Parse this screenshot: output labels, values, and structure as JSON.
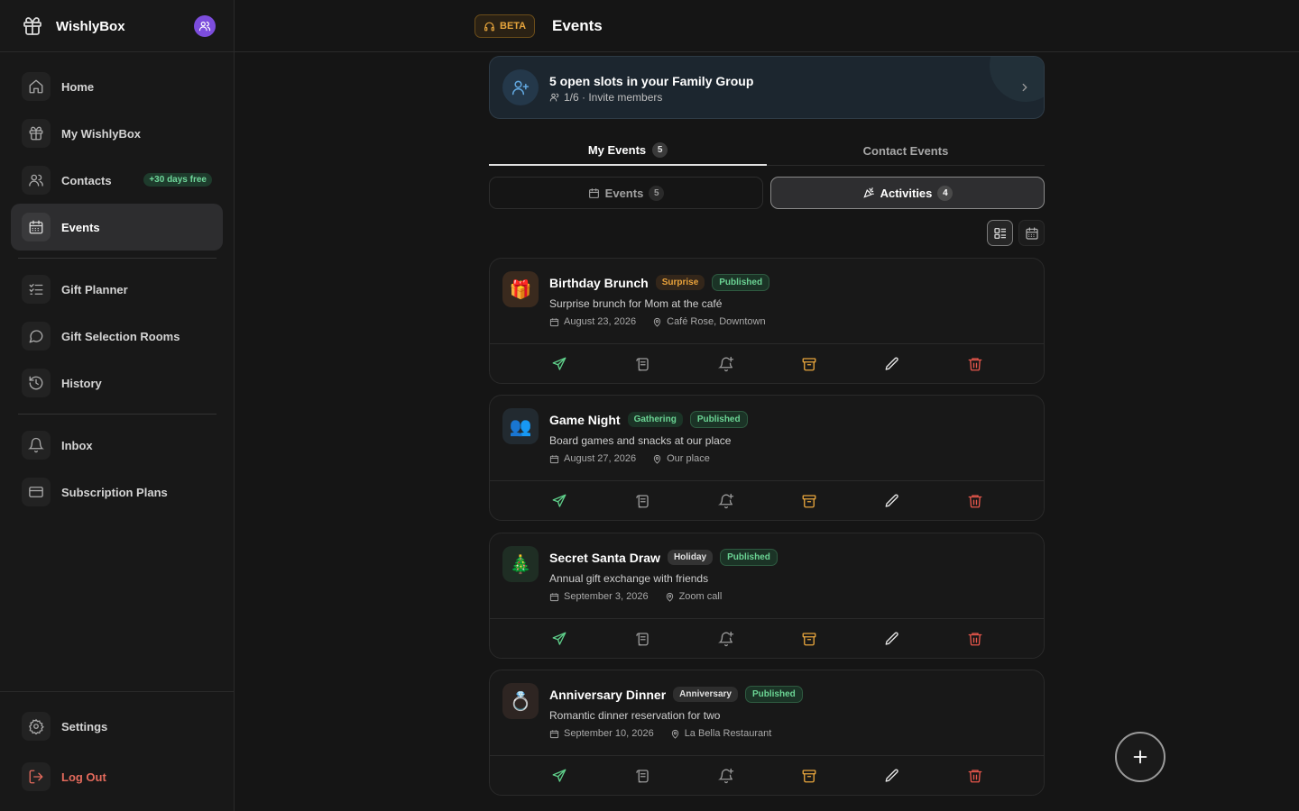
{
  "app": {
    "name": "WishlyBox"
  },
  "header": {
    "beta_label": "BETA",
    "title": "Events"
  },
  "sidebar": {
    "items": [
      {
        "label": "Home",
        "icon": "home-icon"
      },
      {
        "label": "My WishlyBox",
        "icon": "gift-icon"
      },
      {
        "label": "Contacts",
        "icon": "users-icon",
        "badge": "+30 days free"
      },
      {
        "label": "Events",
        "icon": "calendar-icon",
        "active": true
      },
      {
        "label": "Gift Planner",
        "icon": "checklist-icon"
      },
      {
        "label": "Gift Selection Rooms",
        "icon": "chat-icon"
      },
      {
        "label": "History",
        "icon": "history-icon"
      },
      {
        "label": "Inbox",
        "icon": "bell-icon"
      },
      {
        "label": "Subscription Plans",
        "icon": "credit-card-icon"
      }
    ],
    "settings_label": "Settings",
    "logout_label": "Log Out"
  },
  "banner": {
    "title": "5 open slots in your Family Group",
    "subtitle": "1/6 · Invite members"
  },
  "tabs": [
    {
      "label": "My Events",
      "count": "5",
      "active": true
    },
    {
      "label": "Contact Events"
    }
  ],
  "segments": [
    {
      "label": "Events",
      "count": "5"
    },
    {
      "label": "Activities",
      "count": "4",
      "active": true
    }
  ],
  "view_modes": {
    "active": "list"
  },
  "events": [
    {
      "emoji": "🎁",
      "title": "Birthday Brunch",
      "category": "Surprise",
      "status": "Published",
      "description": "Surprise brunch for Mom at the café",
      "date": "August 23, 2026",
      "location": "Café Rose, Downtown",
      "category_color": "#e9a23b",
      "category_bg": "#33261a",
      "emoji_bg": "#3a2a1e"
    },
    {
      "emoji": "👥",
      "title": "Game Night",
      "category": "Gathering",
      "status": "Published",
      "description": "Board games and snacks at our place",
      "date": "August 27, 2026",
      "location": "Our place",
      "category_color": "#6bd494",
      "category_bg": "#1b3326",
      "emoji_bg": "#222a30"
    },
    {
      "emoji": "🎄",
      "title": "Secret Santa Draw",
      "category": "Holiday",
      "status": "Published",
      "description": "Annual gift exchange with friends",
      "date": "September 3, 2026",
      "location": "Zoom call",
      "category_color": "#e0e0e0",
      "category_bg": "#333333",
      "emoji_bg": "#1f2e24"
    },
    {
      "emoji": "💍",
      "title": "Anniversary Dinner",
      "category": "Anniversary",
      "status": "Published",
      "description": "Romantic dinner reservation for two",
      "date": "September 10, 2026",
      "location": "La Bella Restaurant",
      "category_color": "#e0e0e0",
      "category_bg": "#2e2e2e",
      "emoji_bg": "#2e2522"
    }
  ],
  "action_colors": {
    "send": "#5fcf8a",
    "notes": "#9a9a9a",
    "remind": "#9a9a9a",
    "archive": "#e7a53c",
    "edit": "#e8e8e8",
    "delete": "#e5564b"
  }
}
